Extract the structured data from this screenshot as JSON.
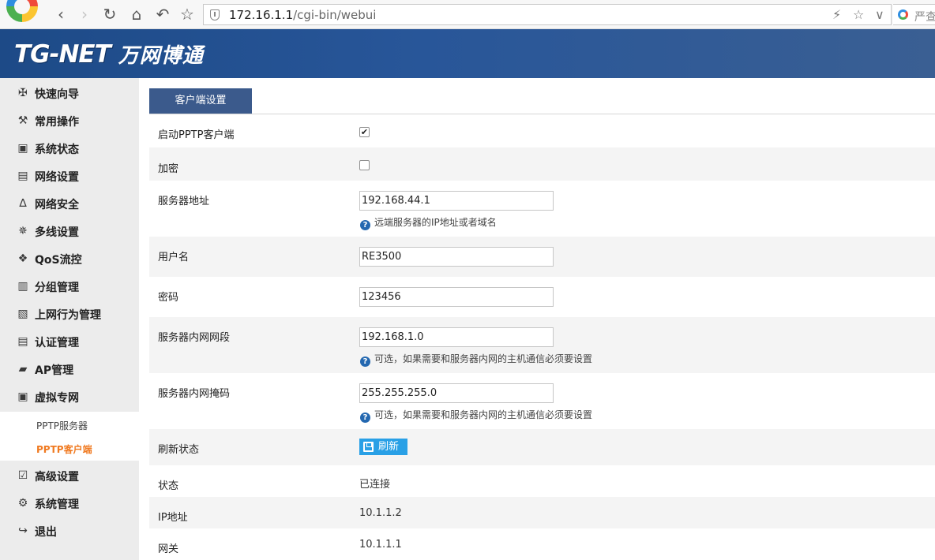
{
  "browser": {
    "url_host": "172.16.1.1",
    "url_path": "/cgi-bin/webui",
    "search_text": "严查"
  },
  "header": {
    "logo_brand": "TG-NET",
    "logo_cn": "万网博通"
  },
  "sidebar": {
    "items": [
      {
        "label": "快速向导",
        "icon": "signpost-icon"
      },
      {
        "label": "常用操作",
        "icon": "wrench-icon"
      },
      {
        "label": "系统状态",
        "icon": "monitor-chart-icon"
      },
      {
        "label": "网络设置",
        "icon": "network-card-icon"
      },
      {
        "label": "网络安全",
        "icon": "security-icon"
      },
      {
        "label": "多线设置",
        "icon": "multiline-icon"
      },
      {
        "label": "QoS流控",
        "icon": "qos-icon"
      },
      {
        "label": "分组管理",
        "icon": "folders-icon"
      },
      {
        "label": "上网行为管理",
        "icon": "behavior-icon"
      },
      {
        "label": "认证管理",
        "icon": "document-icon"
      },
      {
        "label": "AP管理",
        "icon": "ap-folder-icon"
      },
      {
        "label": "虚拟专网",
        "icon": "lock-icon"
      },
      {
        "label": "高级设置",
        "icon": "checklist-icon"
      },
      {
        "label": "系统管理",
        "icon": "gear-icon"
      },
      {
        "label": "退出",
        "icon": "logout-icon"
      }
    ],
    "submenu": [
      {
        "label": "PPTP服务器",
        "active": false
      },
      {
        "label": "PPTP客户端",
        "active": true
      }
    ]
  },
  "tab": {
    "label": "客户端设置"
  },
  "form": {
    "enable_label": "启动PPTP客户端",
    "enable_checked": true,
    "encrypt_label": "加密",
    "encrypt_checked": false,
    "server_label": "服务器地址",
    "server_value": "192.168.44.1",
    "server_hint": "远端服务器的IP地址或者域名",
    "username_label": "用户名",
    "username_value": "RE3500",
    "password_label": "密码",
    "password_value": "123456",
    "subnet_label": "服务器内网网段",
    "subnet_value": "192.168.1.0",
    "subnet_hint": "可选，如果需要和服务器内网的主机通信必须要设置",
    "mask_label": "服务器内网掩码",
    "mask_value": "255.255.255.0",
    "mask_hint": "可选，如果需要和服务器内网的主机通信必须要设置",
    "refresh_label": "刷新状态",
    "refresh_button": "刷新",
    "status_label": "状态",
    "status_value": "已连接",
    "ip_label": "IP地址",
    "ip_value": "10.1.1.2",
    "gateway_label": "网关",
    "gateway_value": "10.1.1.1"
  }
}
